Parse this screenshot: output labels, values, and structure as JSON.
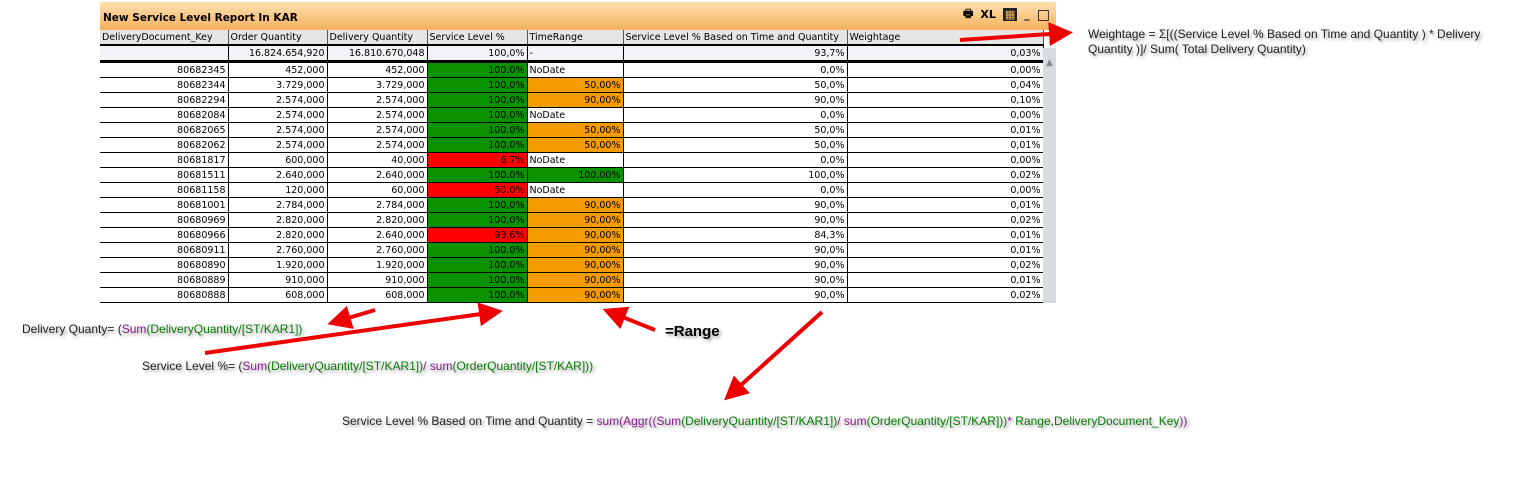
{
  "window": {
    "title": "New Service Level Report  In KAR",
    "controls": {
      "print": "🖶",
      "excel": "XL",
      "chart": "▦",
      "minimize": "_",
      "maximize": "□"
    }
  },
  "table": {
    "headers": [
      "DeliveryDocument_Key",
      "Order Quantity",
      "Delivery Quantity",
      "Service Level %",
      "TimeRange",
      "Service Level % Based on Time and Quantity",
      "Weightage"
    ],
    "total": [
      "",
      "16.824.654,920",
      "16.810.670,048",
      "100,0%",
      "-",
      "93,7%",
      "0,03%"
    ],
    "rows": [
      [
        "80682345",
        "452,000",
        "452,000",
        "100,0%",
        "NoDate",
        "0,0%",
        "0,00%"
      ],
      [
        "80682344",
        "3.729,000",
        "3.729,000",
        "100,0%",
        "50,00%",
        "50,0%",
        "0,04%"
      ],
      [
        "80682294",
        "2.574,000",
        "2.574,000",
        "100,0%",
        "90,00%",
        "90,0%",
        "0,10%"
      ],
      [
        "80682084",
        "2.574,000",
        "2.574,000",
        "100,0%",
        "NoDate",
        "0,0%",
        "0,00%"
      ],
      [
        "80682065",
        "2.574,000",
        "2.574,000",
        "100,0%",
        "50,00%",
        "50,0%",
        "0,01%"
      ],
      [
        "80682062",
        "2.574,000",
        "2.574,000",
        "100,0%",
        "50,00%",
        "50,0%",
        "0,01%"
      ],
      [
        "80681817",
        "600,000",
        "40,000",
        "6,7%",
        "NoDate",
        "0,0%",
        "0,00%"
      ],
      [
        "80681511",
        "2.640,000",
        "2.640,000",
        "100,0%",
        "100,00%",
        "100,0%",
        "0,02%"
      ],
      [
        "80681158",
        "120,000",
        "60,000",
        "50,0%",
        "NoDate",
        "0,0%",
        "0,00%"
      ],
      [
        "80681001",
        "2.784,000",
        "2.784,000",
        "100,0%",
        "90,00%",
        "90,0%",
        "0,01%"
      ],
      [
        "80680969",
        "2.820,000",
        "2.820,000",
        "100,0%",
        "90,00%",
        "90,0%",
        "0,02%"
      ],
      [
        "80680966",
        "2.820,000",
        "2.640,000",
        "93,6%",
        "90,00%",
        "84,3%",
        "0,01%"
      ],
      [
        "80680911",
        "2.760,000",
        "2.760,000",
        "100,0%",
        "90,00%",
        "90,0%",
        "0,01%"
      ],
      [
        "80680890",
        "1.920,000",
        "1.920,000",
        "100,0%",
        "90,00%",
        "90,0%",
        "0,02%"
      ],
      [
        "80680889",
        "910,000",
        "910,000",
        "100,0%",
        "90,00%",
        "90,0%",
        "0,01%"
      ],
      [
        "80680888",
        "608,000",
        "608,000",
        "100,0%",
        "90,00%",
        "90,0%",
        "0,02%"
      ]
    ]
  },
  "colors": {
    "green": "#0a9200",
    "red": "#ff0000",
    "orange": "#f49b00"
  },
  "annotations": {
    "weightage": [
      "Weightage = Σ[((Service Level % Based on Time and Quantity ) * Delivery",
      "Quantity )]/ Sum( Total Delivery Quantity)"
    ],
    "delivery": [
      [
        "plain",
        "Delivery Quanty= ("
      ],
      [
        "fn",
        "Sum"
      ],
      [
        "fld",
        "(DeliveryQuantity/[ST/KAR1])"
      ]
    ],
    "range": "=Range",
    "service": [
      [
        "plain",
        "Service Level %= ("
      ],
      [
        "fn",
        "Sum"
      ],
      [
        "fld",
        "(DeliveryQuantity/[ST/KAR1])"
      ],
      [
        "fn",
        "/ sum"
      ],
      [
        "fld",
        "(OrderQuantity/[ST/KAR]))"
      ]
    ],
    "based": [
      [
        "plain",
        "Service Level % Based on Time and Quantity = "
      ],
      [
        "fn",
        "sum(Aggr(("
      ],
      [
        "fn",
        "Sum"
      ],
      [
        "fld",
        "(DeliveryQuantity/[ST/KAR1])"
      ],
      [
        "fn",
        "/ sum"
      ],
      [
        "fld",
        "(OrderQuantity/[ST/KAR]))"
      ],
      [
        "fn",
        "* "
      ],
      [
        "fld",
        "Range,DeliveryDocument_Key"
      ],
      [
        "fn",
        "))"
      ]
    ]
  }
}
